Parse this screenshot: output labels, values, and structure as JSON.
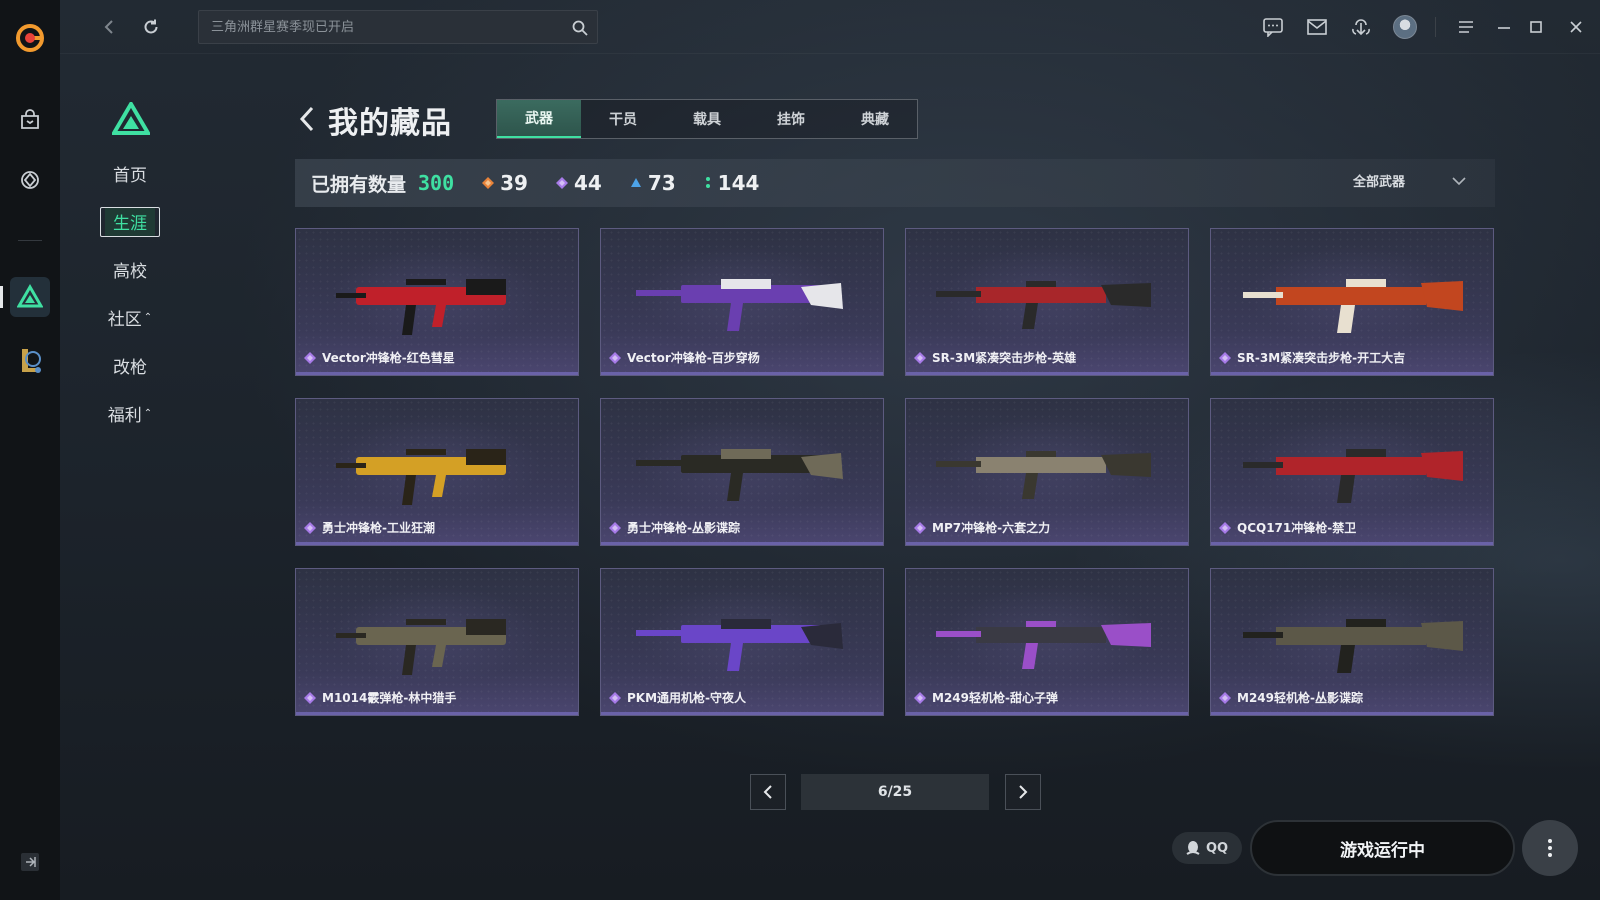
{
  "search": {
    "placeholder": "三角洲群星赛季现已开启"
  },
  "sidebar": {
    "items": [
      {
        "label": "首页",
        "caret": ""
      },
      {
        "label": "生涯",
        "caret": ""
      },
      {
        "label": "高校",
        "caret": ""
      },
      {
        "label": "社区",
        "caret": "⌃"
      },
      {
        "label": "改枪",
        "caret": ""
      },
      {
        "label": "福利",
        "caret": "⌃"
      }
    ],
    "active_index": 1
  },
  "header": {
    "title": "我的藏品",
    "tabs": [
      "武器",
      "干员",
      "载具",
      "挂饰",
      "典藏"
    ],
    "active_tab": 0
  },
  "stats": {
    "label": "已拥有数量",
    "total": "300",
    "counts": [
      {
        "value": "39",
        "color": "#e8833a"
      },
      {
        "value": "44",
        "color": "#a77be8"
      },
      {
        "value": "73",
        "color": "#4da3e8"
      },
      {
        "value": "144",
        "color": "#3fe0a2"
      }
    ],
    "filter_label": "全部武器"
  },
  "cards": [
    {
      "name": "Vector冲锋枪-红色彗星",
      "gem_color": "#a77be8",
      "palette": [
        "#c0202a",
        "#1a1a1a"
      ]
    },
    {
      "name": "Vector冲锋枪-百步穿杨",
      "gem_color": "#a77be8",
      "palette": [
        "#e6e6ea",
        "#6a3fb0"
      ]
    },
    {
      "name": "SR-3M紧凑突击步枪-英雄",
      "gem_color": "#a77be8",
      "palette": [
        "#a8262a",
        "#2a2a2a"
      ]
    },
    {
      "name": "SR-3M紧凑突击步枪-开工大吉",
      "gem_color": "#a77be8",
      "palette": [
        "#c2461f",
        "#e8e0d0"
      ]
    },
    {
      "name": "勇士冲锋枪-工业狂潮",
      "gem_color": "#a77be8",
      "palette": [
        "#d4a025",
        "#2a2418"
      ]
    },
    {
      "name": "勇士冲锋枪-丛影谍踪",
      "gem_color": "#a77be8",
      "palette": [
        "#6f6a58",
        "#2a2a24"
      ]
    },
    {
      "name": "MP7冲锋枪-六套之力",
      "gem_color": "#a77be8",
      "palette": [
        "#8a8270",
        "#3a3830"
      ]
    },
    {
      "name": "QCQ171冲锋枪-禁卫",
      "gem_color": "#a77be8",
      "palette": [
        "#b0242a",
        "#2a2a2a"
      ]
    },
    {
      "name": "M1014霰弹枪-林中猎手",
      "gem_color": "#a77be8",
      "palette": [
        "#6a6550",
        "#2a2822"
      ]
    },
    {
      "name": "PKM通用机枪-守夜人",
      "gem_color": "#a77be8",
      "palette": [
        "#2a2a3a",
        "#6a46c8"
      ]
    },
    {
      "name": "M249轻机枪-甜心子弹",
      "gem_color": "#a77be8",
      "palette": [
        "#3a3a44",
        "#9a4fc8"
      ]
    },
    {
      "name": "M249轻机枪-丛影谍踪",
      "gem_color": "#a77be8",
      "palette": [
        "#5c5848",
        "#22221e"
      ]
    }
  ],
  "pagination": {
    "text": "6/25"
  },
  "bottom": {
    "qq_label": "QQ",
    "play_label": "游戏运行中"
  }
}
